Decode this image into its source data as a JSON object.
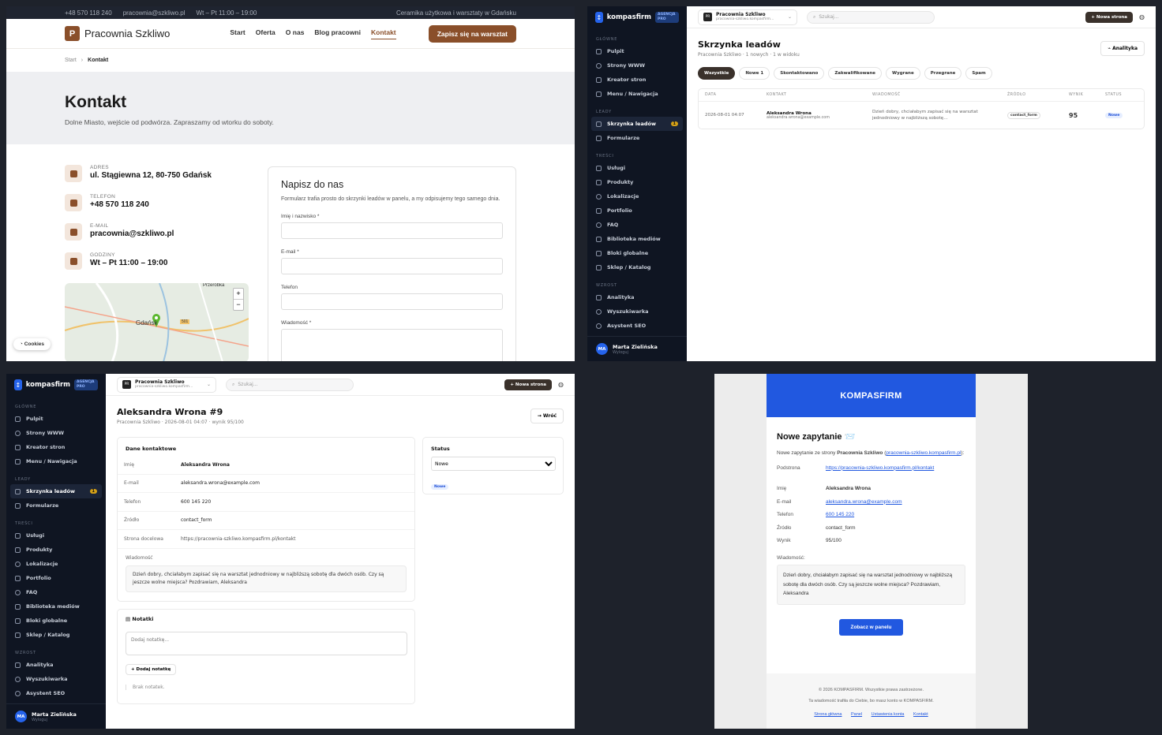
{
  "site": {
    "topbar": {
      "phone": "+48 570 118 240",
      "email": "pracownia@szkliwo.pl",
      "hours": "Wt – Pt 11:00 – 19:00",
      "tagline": "Ceramika użytkowa i warsztaty w Gdańsku"
    },
    "logo_letter": "P",
    "name": "Pracownia Szkliwo",
    "nav": [
      "Start",
      "Oferta",
      "O nas",
      "Blog pracowni",
      "Kontakt"
    ],
    "cta": "Zapisz się na warsztat",
    "breadcrumb": [
      "Start",
      "Kontakt"
    ],
    "hero_title": "Kontakt",
    "hero_subtitle": "Dolne Miasto, wejście od podwórza. Zapraszamy od wtorku do soboty.",
    "info": [
      {
        "label": "ADRES",
        "value": "ul. Stągiewna 12, 80-750 Gdańsk"
      },
      {
        "label": "TELEFON",
        "value": "+48 570 118 240"
      },
      {
        "label": "E-MAIL",
        "value": "pracownia@szkliwo.pl"
      },
      {
        "label": "GODZINY",
        "value": "Wt – Pt 11:00 – 19:00"
      }
    ],
    "map_labels": {
      "district": "Przeróbka",
      "city": "Gdańsk",
      "road": "501",
      "zoom_in": "+",
      "zoom_out": "−"
    },
    "form": {
      "title": "Napisz do nas",
      "desc": "Formularz trafia prosto do skrzynki leadów w panelu, a my odpisujemy tego samego dnia.",
      "fields": [
        "Imię i nazwisko *",
        "E-mail *",
        "Telefon",
        "Wiadomość *"
      ]
    },
    "cookies": "Cookies"
  },
  "admin": {
    "brand": "kompasfirm",
    "badge": "AGENCJA PRO",
    "site_name": "Pracownia Szkliwo",
    "site_url": "pracownia-szkliwo.kompasfirm…",
    "search_placeholder": "Szukaj...",
    "new_page": "Nowa strona",
    "groups": [
      {
        "label": "GŁÓWNE",
        "items": [
          "Pulpit",
          "Strony WWW",
          "Kreator stron",
          "Menu / Nawigacja"
        ]
      },
      {
        "label": "LEADY",
        "items": [
          "Skrzynka leadów",
          "Formularze"
        ]
      },
      {
        "label": "TREŚCI",
        "items": [
          "Usługi",
          "Produkty",
          "Lokalizacje",
          "Portfolio",
          "FAQ",
          "Biblioteka mediów",
          "Bloki globalne",
          "Sklep / Katalog"
        ]
      },
      {
        "label": "WZROST",
        "items": [
          "Analityka",
          "Wyszukiwarka",
          "Asystent SEO"
        ]
      }
    ],
    "leads_count": "1",
    "user": {
      "initials": "MA",
      "name": "Marta Zielińska",
      "logout": "Wyloguj"
    }
  },
  "inbox": {
    "title": "Skrzynka leadów",
    "subtitle": "Pracownia Szkliwo · 1 nowych · 1 w widoku",
    "analytics_btn": "Analityka",
    "filters": [
      "Wszystkie",
      "Nowe 1",
      "Skontaktowano",
      "Zakwalifikowane",
      "Wygrane",
      "Przegrane",
      "Spam"
    ],
    "columns": [
      "DATA",
      "KONTAKT",
      "WIADOMOŚĆ",
      "ŹRÓDŁO",
      "WYNIK",
      "STATUS"
    ],
    "rows": [
      {
        "date": "2026-08-01 04:07",
        "name": "Aleksandra Wrona",
        "email": "aleksandra.wrona@example.com",
        "message": "Dzień dobry, chciałabym zapisać się na warsztat jednodniowy w najbliższą sobotę…",
        "source": "contact_form",
        "score": "95",
        "status": "Nowe"
      }
    ]
  },
  "lead": {
    "title": "Aleksandra Wrona #9",
    "subtitle": "Pracownia Szkliwo · 2026-08-01 04:07 · wynik 95/100",
    "back": "Wróć",
    "contact_title": "Dane kontaktowe",
    "fields": [
      {
        "k": "Imię",
        "v": "Aleksandra Wrona"
      },
      {
        "k": "E-mail",
        "v": "aleksandra.wrona@example.com"
      },
      {
        "k": "Telefon",
        "v": "600 145 220"
      },
      {
        "k": "Źródło",
        "v": "contact_form"
      },
      {
        "k": "Strona docelowa",
        "v": "https://pracownia-szkliwo.kompasfirm.pl/kontakt"
      }
    ],
    "message_label": "Wiadomość",
    "message": "Dzień dobry, chciałabym zapisać się na warsztat jednodniowy w najbliższą sobotę dla dwóch osób. Czy są jeszcze wolne miejsca? Pozdrawiam, Aleksandra",
    "status_title": "Status",
    "status_value": "Nowe",
    "status_badge": "Nowe",
    "notes_title": "Notatki",
    "note_placeholder": "Dodaj notatkę...",
    "add_note": "Dodaj notatkę",
    "no_notes": "Brak notatek."
  },
  "email": {
    "brand": "KOMPASFIRM",
    "heading": "Nowe zapytanie 📨",
    "intro_pre": "Nowe zapytanie ze strony ",
    "intro_site": "Pracownia Szkliwo",
    "intro_link": "pracownia-szkliwo.kompasfirm.pl",
    "page_label": "Podstrona",
    "page_url": "https://pracownia-szkliwo.kompasfirm.pl/kontakt",
    "rows": [
      {
        "k": "Imię",
        "v": "Aleksandra Wrona"
      },
      {
        "k": "E-mail",
        "v": "aleksandra.wrona@example.com"
      },
      {
        "k": "Telefon",
        "v": "600 145 220"
      },
      {
        "k": "Źródło",
        "v": "contact_form"
      },
      {
        "k": "Wynik",
        "v": "95/100"
      }
    ],
    "message_label": "Wiadomość:",
    "message": "Dzień dobry, chciałabym zapisać się na warsztat jednodniowy w najbliższą sobotę dla dwóch osób. Czy są jeszcze wolne miejsca? Pozdrawiam, Aleksandra",
    "button": "Zobacz w panelu",
    "footer_copy": "© 2026 KOMPASFIRM. Wszystkie prawa zastrzeżone.",
    "footer_note": "Ta wiadomość trafiła do Ciebie, bo masz konto w KOMPASFIRM.",
    "footer_links": [
      "Strona główna",
      "Panel",
      "Ustawienia konta",
      "Kontakt"
    ]
  },
  "colors": {
    "brand_brown": "#8a4f2a",
    "admin_dark": "#0f1522",
    "accent_blue": "#2158e0"
  }
}
